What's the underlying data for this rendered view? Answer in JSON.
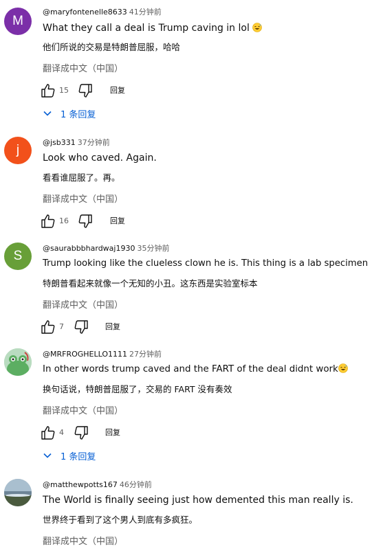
{
  "comments": [
    {
      "avatar_letter": "M",
      "avatar_color": "#7b2fa8",
      "username": "@maryfontenelle8633",
      "time": "41分钟前",
      "text_en": "What they call a deal is Trump caving in lol",
      "emoji": "grinning-sweat-emoji",
      "text_zh": "他们所说的交易是特朗普屈服，哈哈",
      "translate_label": "翻译成中文（中国）",
      "likes": "15",
      "reply_label": "回复",
      "replies_label": "1 条回复"
    },
    {
      "avatar_letter": "j",
      "avatar_color": "#f2511b",
      "username": "@jsb331",
      "time": "37分钟前",
      "text_en": "Look who caved. Again.",
      "text_zh": "看看谁屈服了。再。",
      "translate_label": "翻译成中文（中国）",
      "likes": "16",
      "reply_label": "回复"
    },
    {
      "avatar_letter": "S",
      "avatar_color": "#689f38",
      "username": "@saurabbbhardwaj1930",
      "time": "35分钟前",
      "text_en": "Trump looking like the clueless clown he is. This thing is a lab specimen",
      "text_zh": "特朗普看起来就像一个无知的小丑。这东西是实验室标本",
      "translate_label": "翻译成中文（中国）",
      "likes": "7",
      "reply_label": "回复"
    },
    {
      "avatar_color": "#9fc8a2",
      "username": "@MRFROGHELLO1111",
      "time": "27分钟前",
      "text_en": "In other words trump caved and the FART of the deal didnt work",
      "emoji": "grinning-sweat-emoji",
      "text_zh": "换句话说，特朗普屈服了，交易的 FART 没有奏效",
      "translate_label": "翻译成中文（中国）",
      "likes": "4",
      "reply_label": "回复",
      "replies_label": "1 条回复"
    },
    {
      "avatar_color": "#8fa3b0",
      "username": "@matthewpotts167",
      "time": "46分钟前",
      "text_en": "The World is finally seeing just how demented this man really is.",
      "text_zh": "世界终于看到了这个男人到底有多疯狂。",
      "translate_label": "翻译成中文（中国）"
    }
  ],
  "icons": {
    "like": "thumb-up-icon",
    "dislike": "thumb-down-icon",
    "expand": "chevron-down-icon",
    "reply_link_color": "#065fd4"
  }
}
